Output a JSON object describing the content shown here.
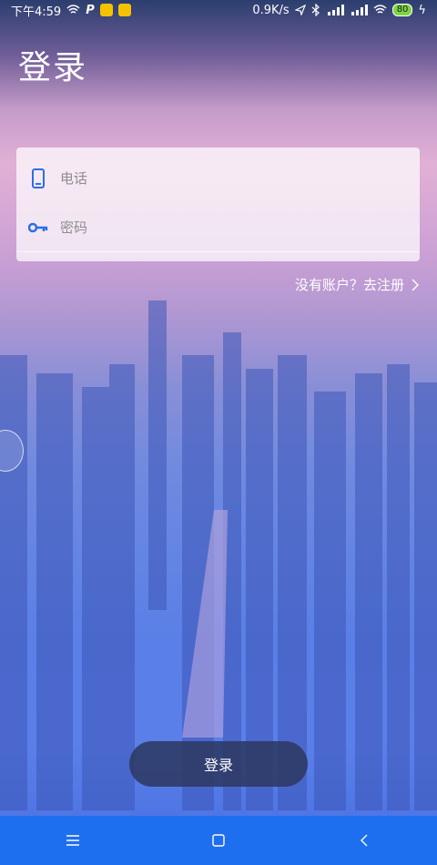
{
  "status_bar": {
    "time": "下午4:59",
    "network_speed": "0.9K/s",
    "battery": "80",
    "colors": {
      "app_icon": "#f4c300",
      "battery_fill": "#7cd442"
    },
    "icons": [
      "wifi-icon",
      "parking-icon",
      "app-notification-icon",
      "location-icon",
      "bluetooth-icon",
      "signal-icon",
      "battery-icon",
      "charging-icon"
    ]
  },
  "header": {
    "title": "登录"
  },
  "form": {
    "phone_placeholder": "电话",
    "password_placeholder": "密码",
    "icon_color": "#2a6fe6"
  },
  "register_link": {
    "label": "没有账户？去注册"
  },
  "login_button": {
    "label": "登录"
  },
  "nav_bar": {
    "color": "#1e6ef0",
    "icons": [
      "menu-icon",
      "home-icon",
      "back-icon"
    ]
  }
}
